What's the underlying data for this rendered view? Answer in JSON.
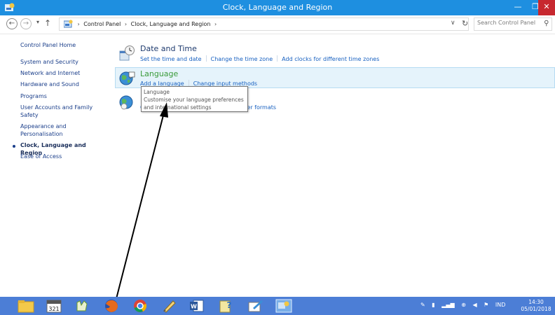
{
  "window": {
    "title": "Clock, Language and Region",
    "minimize_glyph": "—",
    "maximize_glyph": "❐",
    "close_glyph": "✕"
  },
  "addressbar": {
    "back_glyph": "←",
    "forward_glyph": "→",
    "recent_glyph": "▾",
    "up_glyph": "↑",
    "breadcrumb": [
      "Control Panel",
      "Clock, Language and Region"
    ],
    "breadcrumb_sep": "›",
    "dropdown_glyph": "∨",
    "refresh_glyph": "↻",
    "search_placeholder": "Search Control Panel",
    "search_glyph": "⚲"
  },
  "sidebar": {
    "home": "Control Panel Home",
    "items": [
      {
        "label": "System and Security"
      },
      {
        "label": "Network and Internet"
      },
      {
        "label": "Hardware and Sound"
      },
      {
        "label": "Programs"
      },
      {
        "label": "User Accounts and Family Safety"
      },
      {
        "label": "Appearance and Personalisation"
      },
      {
        "label": "Clock, Language and Region"
      },
      {
        "label": "Ease of Access"
      }
    ]
  },
  "categories": [
    {
      "title": "Date and Time",
      "links": [
        "Set the time and date",
        "Change the time zone",
        "Add clocks for different time zones"
      ]
    },
    {
      "title": "Language",
      "links": [
        "Add a language",
        "Change input methods"
      ]
    },
    {
      "title": "",
      "links": [
        "C",
        "r number formats"
      ]
    }
  ],
  "tooltip": {
    "lines": [
      "Language",
      "Customise your language preferences",
      "and international settings"
    ]
  },
  "taskbar": {
    "apps": [
      "file-explorer",
      "calendar",
      "hand-app",
      "firefox",
      "chrome",
      "paint-tool",
      "word",
      "help",
      "notepad",
      "control-panel"
    ]
  },
  "tray": {
    "keyboard": "IND",
    "time": "14:30",
    "date": "05/01/2018"
  },
  "colors": {
    "titlebar": "#1e8fe0",
    "taskbar": "#4c7ed6",
    "link": "#1760c0",
    "highlight": "#e5f3fb",
    "language_title": "#3a9b3a"
  }
}
